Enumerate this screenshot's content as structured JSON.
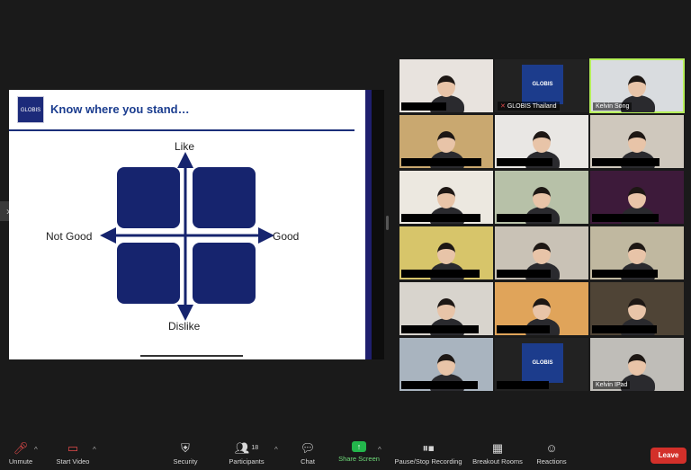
{
  "slide": {
    "logo_text": "GLOBIS",
    "title": "Know where you stand…",
    "axis": {
      "top": "Like",
      "bottom": "Dislike",
      "left": "Not Good",
      "right": "Good"
    }
  },
  "participants": [
    {
      "name": "",
      "bg": "#e8e3de"
    },
    {
      "name": "GLOBIS Thailand",
      "bg": "#222222",
      "muted": true,
      "logo": "GLOBIS"
    },
    {
      "name": "Kelvin Song",
      "bg": "#d9dcdf",
      "active": true
    },
    {
      "name": "",
      "bg": "#c9a870"
    },
    {
      "name": "",
      "bg": "#e9e7e4"
    },
    {
      "name": "",
      "bg": "#cfc8bd"
    },
    {
      "name": "",
      "bg": "#ece8e0"
    },
    {
      "name": "",
      "bg": "#b7c1a8"
    },
    {
      "name": "",
      "bg": "#3d1a3a"
    },
    {
      "name": "",
      "bg": "#d7c56a"
    },
    {
      "name": "",
      "bg": "#c9c2b6"
    },
    {
      "name": "",
      "bg": "#c0b8a0"
    },
    {
      "name": "",
      "bg": "#d8d4cd"
    },
    {
      "name": "",
      "bg": "#e0a45a"
    },
    {
      "name": "",
      "bg": "#4f4436"
    },
    {
      "name": "",
      "bg": "#a9b4bf"
    },
    {
      "name": "",
      "bg": "#222222",
      "logo": "GLOBIS"
    },
    {
      "name": "Kelvin IPad",
      "bg": "#bfbdb8"
    }
  ],
  "toolbar": {
    "unmute": "Unmute",
    "start_video": "Start Video",
    "security": "Security",
    "participants": "Participants",
    "participants_count": "18",
    "chat": "Chat",
    "share_screen": "Share Screen",
    "record": "Pause/Stop Recording",
    "breakout": "Breakout Rooms",
    "reactions": "Reactions",
    "leave": "Leave"
  },
  "colors": {
    "accent_green": "#b6f05a",
    "share_green": "#23b64c",
    "leave_red": "#d3302a",
    "slide_navy": "#16246e"
  }
}
